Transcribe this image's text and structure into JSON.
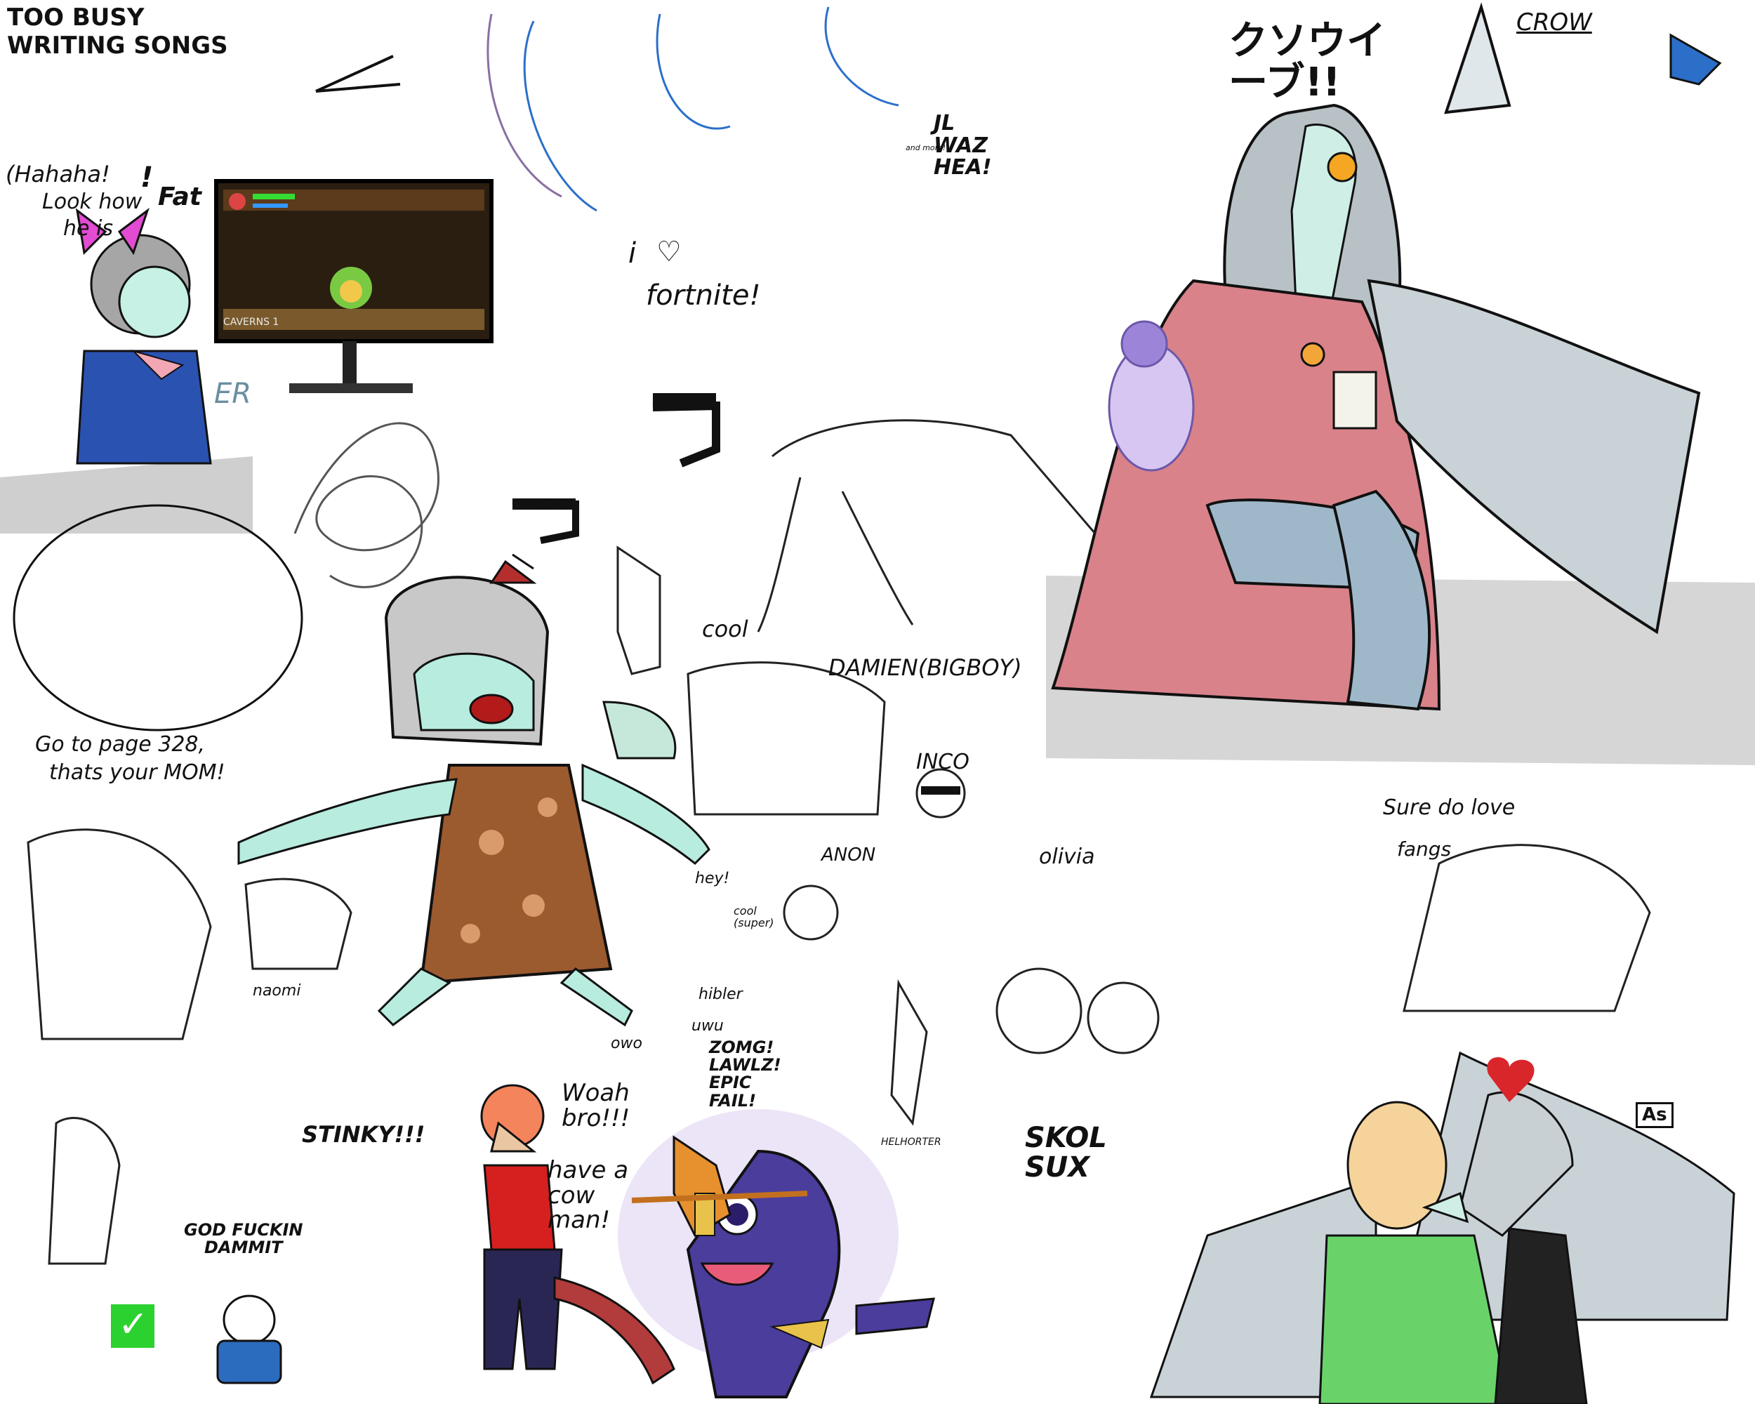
{
  "doodles": {
    "top_left_caption_1": "TOO BUSY",
    "top_left_caption_2": "WRITING SONGS",
    "hahaha": "(Hahaha!",
    "look_how": "Look how",
    "he_is": "he is",
    "fat": "Fat",
    "exclaim": "!",
    "er_tag": "ER",
    "game_hud_title": "CAVERNS 1",
    "go_to_page": "Go to page 328,",
    "thats_your_mom": "thats your MOM!",
    "i_love": "i",
    "fortnite": "fortnite!",
    "jl_waz_hea": "JL\nWAZ\nHEA!",
    "and_more": "and more!",
    "crow": "CROW",
    "katakana": "クソウイ\nーブ!!",
    "cool": "cool",
    "damien": "DAMIEN(BIGBOY)",
    "inco": "INCO",
    "anon": "ANON",
    "olivia": "olivia",
    "sure_do_love": "Sure do love",
    "fangs": "fangs",
    "naomi": "naomi",
    "hey": "hey!",
    "cool_super": "cool\n(super)",
    "hibler": "hibler",
    "owo": "owo",
    "uwu": "uwu",
    "zomg": "ZOMG!\nLAWLZ!\nEPIC\nFAIL!",
    "helhorter": "HELHORTER",
    "woah_bro": "Woah\nbro!!!",
    "have_a_cow": "have a\ncow\nman!",
    "stinky": "STINKY!!!",
    "god_dammit": "GOD FUCKIN\nDAMMIT",
    "skol_sux": "SKOL\nSUX",
    "as_tag": "As",
    "check": "✓"
  },
  "colors": {
    "ink": "#111111",
    "blue_sketch": "#2b6fc9",
    "purple_sketch": "#8a6fa3",
    "pink_robe": "#d9828a",
    "jeans": "#9fb8c9",
    "mint_skin": "#b7ecdf",
    "brown_dress": "#9c5a2f",
    "dragon_purple": "#4a3d9c",
    "green_shirt": "#69d36a",
    "red_tank": "#d61f1f",
    "heart_red": "#d9262b",
    "check_green": "#2bd12f",
    "monitor_bg": "#2a1e10",
    "gray_shade": "#cfcfcf"
  }
}
